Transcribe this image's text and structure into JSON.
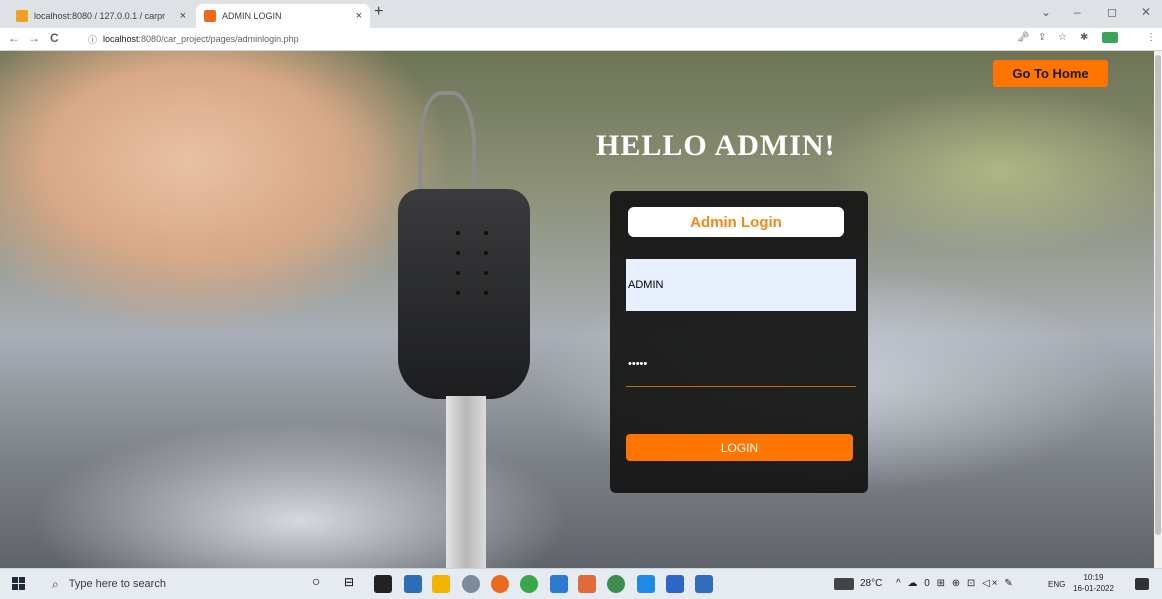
{
  "browser": {
    "tabs": [
      {
        "title": "localhost:8080 / 127.0.0.1 / carpr",
        "close": "×",
        "active": false,
        "favicon_color": "#f0a020"
      },
      {
        "title": "ADMIN LOGIN",
        "close": "×",
        "active": true,
        "favicon_color": "#f06a1e"
      }
    ],
    "new_tab": "+",
    "window_controls": {
      "menu": "⌄",
      "minimize": "–",
      "maximize": "◻",
      "close": "✕"
    },
    "nav": {
      "back": "←",
      "forward": "→",
      "reload": "C"
    },
    "url": {
      "info_icon": "ⓘ",
      "host": "localhost",
      "rest": ":8080/car_project/pages/adminlogin.php"
    },
    "toolbar_icons": {
      "key": "🗝",
      "share": "⇪",
      "star": "☆",
      "extensions": "✱",
      "more": "⋮"
    }
  },
  "page": {
    "go_home_label": "Go To Home",
    "heading": "HELLO ADMIN!",
    "login_card": {
      "title": "Admin Login",
      "username_value": "ADMIN",
      "password_value": "•••••",
      "login_label": "LOGIN"
    }
  },
  "taskbar": {
    "search_placeholder": "Type here to search",
    "weather": "28°C",
    "language": "ENG",
    "time": "10:19",
    "date": "16-01-2022",
    "tray_icons": "^ ☁ 0 ⊞ ⊕ ⊡ ◁× ✎",
    "app_colors": [
      "#222222",
      "#2a6fb5",
      "#f2b400",
      "#7b8b9a",
      "#e86a1e",
      "#38a749",
      "#2b7bd3",
      "#e06a3a",
      "#3c8f4f",
      "#1c8be5",
      "#2b66c8",
      "#2f6dbd"
    ]
  },
  "colors": {
    "accent_orange": "#ff7500",
    "card_title_text": "#ef8a1a",
    "card_bg": "#121212"
  }
}
